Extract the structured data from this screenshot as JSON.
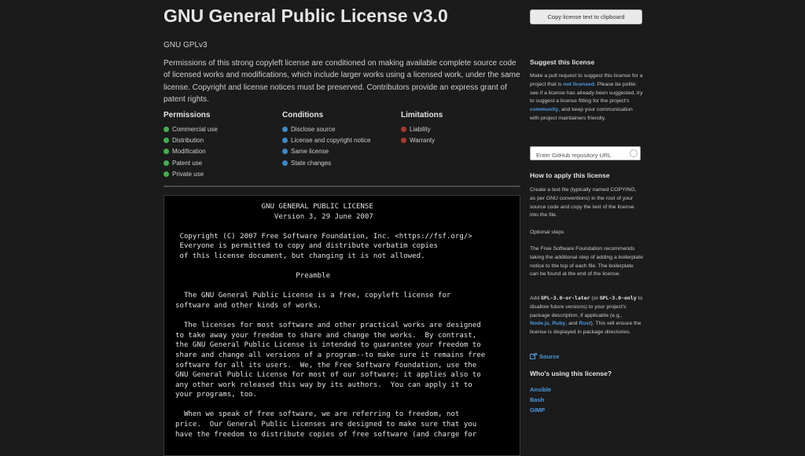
{
  "header": {
    "title": "GNU General Public License v3.0",
    "nickname": "GNU GPLv3",
    "description": "Permissions of this strong copyleft license are conditioned on making available complete source code of licensed works and modifications, which include larger works using a licensed work, under the same license. Copyright and license notices must be preserved. Contributors provide an express grant of patent rights."
  },
  "rules": {
    "permissions": {
      "heading": "Permissions",
      "color": "#3fb24a",
      "items": [
        "Commercial use",
        "Distribution",
        "Modification",
        "Patent use",
        "Private use"
      ]
    },
    "conditions": {
      "heading": "Conditions",
      "color": "#3a8ac9",
      "items": [
        "Disclose source",
        "License and copyright notice",
        "Same license",
        "State changes"
      ]
    },
    "limitations": {
      "heading": "Limitations",
      "color": "#a8382c",
      "items": [
        "Liability",
        "Warranty"
      ]
    }
  },
  "license_text": "                    GNU GENERAL PUBLIC LICENSE\n                       Version 3, 29 June 2007\n\n Copyright (C) 2007 Free Software Foundation, Inc. <https://fsf.org/>\n Everyone is permitted to copy and distribute verbatim copies\n of this license document, but changing it is not allowed.\n\n                            Preamble\n\n  The GNU General Public License is a free, copyleft license for\nsoftware and other kinds of works.\n\n  The licenses for most software and other practical works are designed\nto take away your freedom to share and change the works.  By contrast,\nthe GNU General Public License is intended to guarantee your freedom to\nshare and change all versions of a program--to make sure it remains free\nsoftware for all its users.  We, the Free Software Foundation, use the\nGNU General Public License for most of our software; it applies also to\nany other work released this way by its authors.  You can apply it to\nyour programs, too.\n\n  When we speak of free software, we are referring to freedom, not\nprice.  Our General Public Licenses are designed to make sure that you\nhave the freedom to distribute copies of free software (and charge for",
  "sidebar": {
    "copy_button": "Copy license text to clipboard",
    "suggest": {
      "heading": "Suggest this license",
      "text1": "Make a pull request to suggest this license for a project that is ",
      "link1": "not licensed",
      "text2": ". Please be polite: see if a license has already been suggested, try to suggest a license fitting for the project's ",
      "link2": "community",
      "text3": ", and keep your communication with project maintainers friendly."
    },
    "repo_placeholder": "Enter GitHub repository URL",
    "howto": {
      "heading": "How to apply this license",
      "text": "Create a text file (typically named COPYING, as per GNU conventions) in the root of your source code and copy the text of the license into the file.",
      "optional_heading": "Optional steps",
      "optional_text": "The Free Software Foundation recommends taking the additional step of adding a boilerplate notice to the top of each file. The boilerplate can be found at the end of the license.",
      "add_pre": "Add ",
      "code1": "GPL-3.0-or-later",
      "or_text": " (or ",
      "code2": "GPL-3.0-only",
      "mid_text": " to disallow future versions) to your project's package description, if applicable (e.g., ",
      "node": "Node.js",
      "comma": ", ",
      "ruby": "Ruby",
      "and": ", and ",
      "rust": "Rust",
      "end_text": "). This will ensure the license is displayed in package directories."
    },
    "source_link": "Source",
    "users": {
      "heading": "Who's using this license?",
      "items": [
        "Ansible",
        "Bash",
        "GIMP"
      ]
    }
  }
}
